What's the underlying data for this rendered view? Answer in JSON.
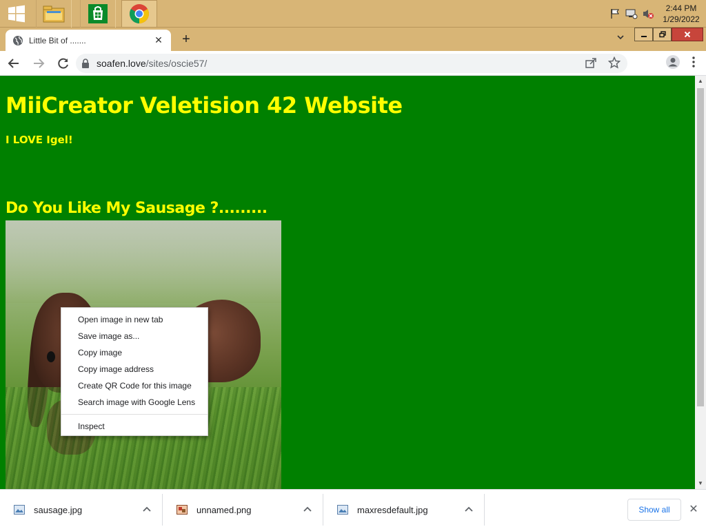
{
  "taskbar": {
    "apps": [
      {
        "name": "file-explorer"
      },
      {
        "name": "store"
      },
      {
        "name": "chrome"
      }
    ],
    "clock": {
      "time": "2:44 PM",
      "date": "1/29/2022"
    }
  },
  "browser": {
    "tab": {
      "title": "Little Bit of ......."
    },
    "url": {
      "host": "soafen.love",
      "path": "/sites/oscie57/"
    }
  },
  "page": {
    "title": "MiiCreator Veletision 42 Website",
    "subtitle": "I LOVE Igel!",
    "heading": "Do You Like My Sausage ?........."
  },
  "context_menu": {
    "items": [
      "Open image in new tab",
      "Save image as...",
      "Copy image",
      "Copy image address",
      "Create QR Code for this image",
      "Search image with Google Lens"
    ],
    "inspect": "Inspect"
  },
  "downloads": {
    "files": [
      "sausage.jpg",
      "unnamed.png",
      "maxresdefault.jpg"
    ],
    "show_all": "Show all"
  },
  "colors": {
    "page_bg": "#008000",
    "page_text": "#ffff00",
    "taskbar": "#d8b576"
  }
}
